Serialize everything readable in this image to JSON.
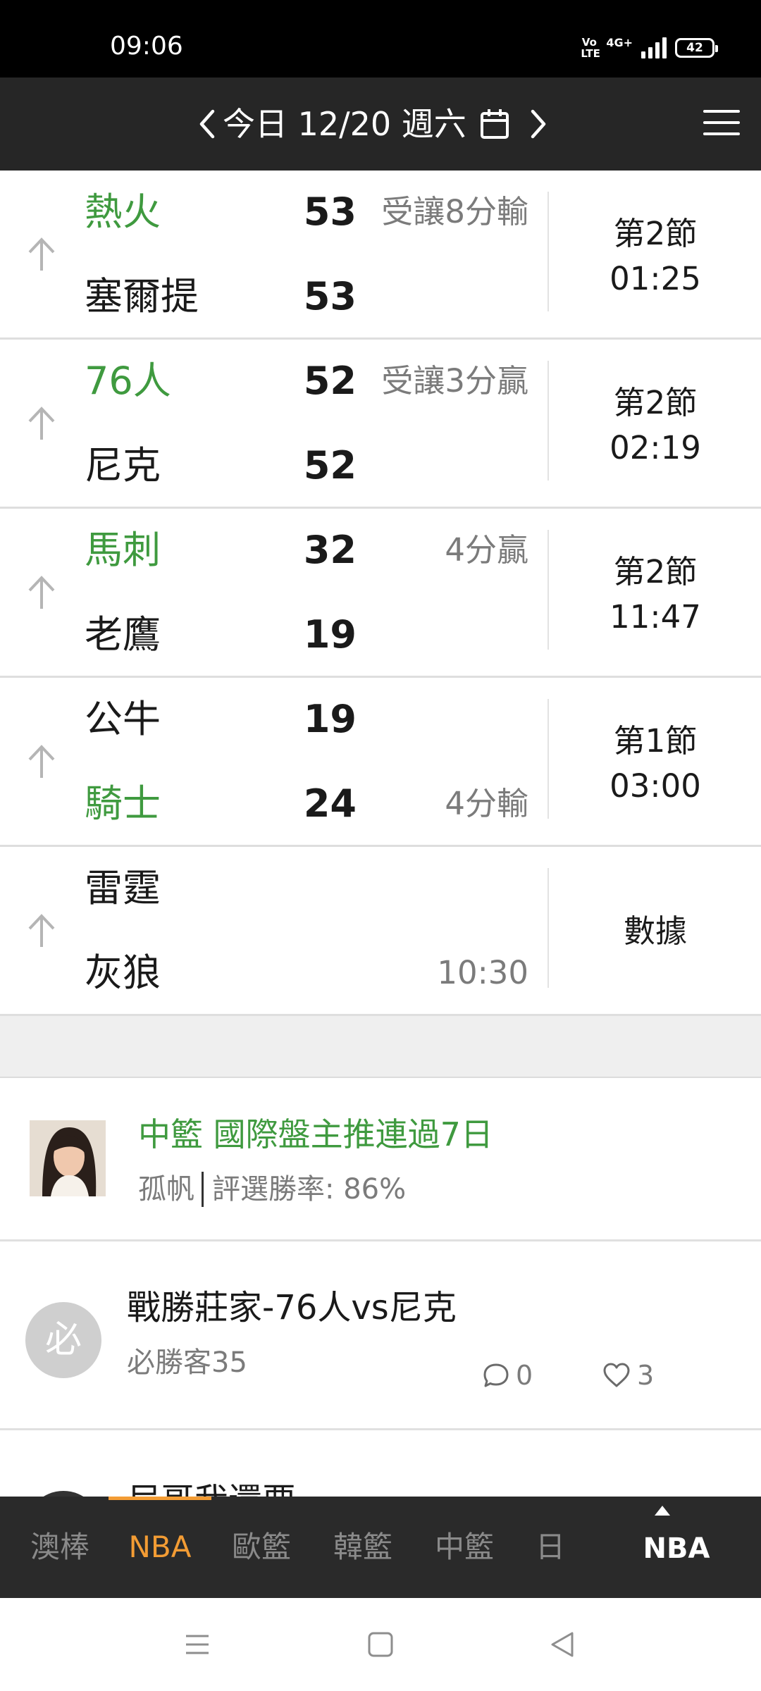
{
  "status_bar": {
    "time": "09:06",
    "volte": "Vo LTE",
    "network": "4G+",
    "battery": "42"
  },
  "header": {
    "date": "今日 12/20 週六"
  },
  "games": [
    {
      "top": {
        "name": "熱火",
        "score": "53",
        "note": "受讓8分輸",
        "green": true
      },
      "bottom": {
        "name": "塞爾提",
        "score": "53",
        "note": "",
        "green": false
      },
      "status": [
        "第2節",
        "01:25"
      ]
    },
    {
      "top": {
        "name": "76人",
        "score": "52",
        "note": "受讓3分贏",
        "green": true
      },
      "bottom": {
        "name": "尼克",
        "score": "52",
        "note": "",
        "green": false
      },
      "status": [
        "第2節",
        "02:19"
      ]
    },
    {
      "top": {
        "name": "馬刺",
        "score": "32",
        "note": "4分贏",
        "green": true
      },
      "bottom": {
        "name": "老鷹",
        "score": "19",
        "note": "",
        "green": false
      },
      "status": [
        "第2節",
        "11:47"
      ]
    },
    {
      "top": {
        "name": "公牛",
        "score": "19",
        "note": "",
        "green": false
      },
      "bottom": {
        "name": "騎士",
        "score": "24",
        "note": "4分輸",
        "green": true
      },
      "status": [
        "第1節",
        "03:00"
      ]
    },
    {
      "top": {
        "name": "雷霆",
        "score": "",
        "note": "",
        "green": false
      },
      "bottom": {
        "name": "灰狼",
        "score": "",
        "note": "10:30",
        "green": false
      },
      "status": [
        "數據"
      ]
    }
  ],
  "expert": {
    "title": "中籃 國際盤主推連過7日",
    "name": "孤帆",
    "win_rate": "評選勝率: 86%"
  },
  "post": {
    "avatar_char": "必",
    "title": "戰勝莊家-76人vs尼克",
    "author": "必勝客35",
    "comments": "0",
    "likes": "3"
  },
  "next_post": {
    "title": "尼哥我還要"
  },
  "tabs": [
    {
      "label": "澳棒",
      "active": false
    },
    {
      "label": "NBA",
      "active": true
    },
    {
      "label": "歐籃",
      "active": false
    },
    {
      "label": "韓籃",
      "active": false
    },
    {
      "label": "中籃",
      "active": false
    },
    {
      "label": "日",
      "active": false
    }
  ],
  "current_league": "NBA",
  "colors": {
    "green": "#3f9a3f",
    "accent": "#f39c34",
    "header": "#262626",
    "tabbar": "#2a2a2a"
  }
}
